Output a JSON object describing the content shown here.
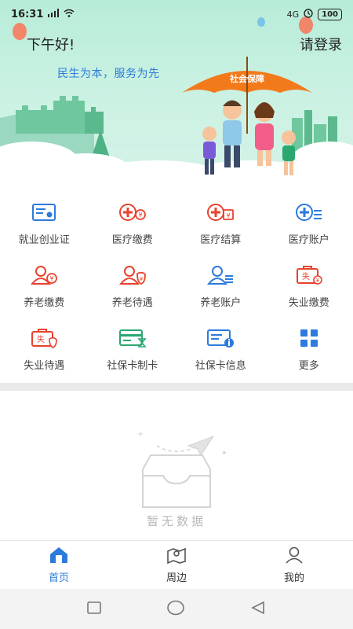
{
  "status_bar": {
    "time": "16:31",
    "network": "4G",
    "battery": "100"
  },
  "header": {
    "greeting": "下午好!",
    "login_label": "请登录",
    "slogan": "民生为本，服务为先",
    "umbrella_text": "社会保障"
  },
  "menu": [
    {
      "label": "就业创业证",
      "icon": "employment-card-icon"
    },
    {
      "label": "医疗缴费",
      "icon": "medical-payment-icon"
    },
    {
      "label": "医疗结算",
      "icon": "medical-settlement-icon"
    },
    {
      "label": "医疗账户",
      "icon": "medical-account-icon"
    },
    {
      "label": "养老缴费",
      "icon": "pension-payment-icon"
    },
    {
      "label": "养老待遇",
      "icon": "pension-benefit-icon"
    },
    {
      "label": "养老账户",
      "icon": "pension-account-icon"
    },
    {
      "label": "失业缴费",
      "icon": "unemployment-payment-icon"
    },
    {
      "label": "失业待遇",
      "icon": "unemployment-benefit-icon"
    },
    {
      "label": "社保卡制卡",
      "icon": "card-making-icon"
    },
    {
      "label": "社保卡信息",
      "icon": "card-info-icon"
    },
    {
      "label": "更多",
      "icon": "more-grid-icon"
    }
  ],
  "empty_state": {
    "text": "暂无数据"
  },
  "bottom_nav": [
    {
      "label": "首页",
      "icon": "home-icon",
      "active": true
    },
    {
      "label": "周边",
      "icon": "map-pin-icon",
      "active": false
    },
    {
      "label": "我的",
      "icon": "user-icon",
      "active": false
    }
  ],
  "colors": {
    "accent_blue": "#2d7bdc",
    "accent_red": "#e8432e",
    "accent_green": "#2aa870",
    "banner_bg": "#c9f1e2",
    "umbrella": "#f27a1a"
  }
}
